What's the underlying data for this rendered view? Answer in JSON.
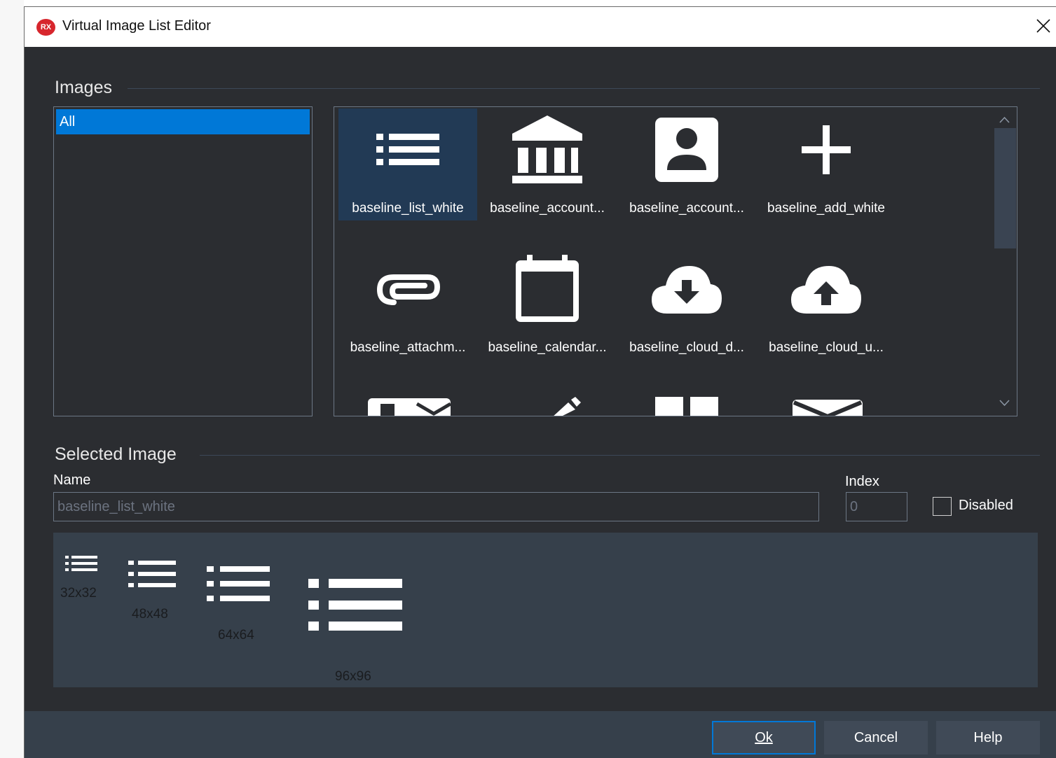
{
  "window": {
    "title": "Virtual Image List Editor",
    "logo_text": "RX"
  },
  "images_group": {
    "title": "Images"
  },
  "categories": [
    {
      "label": "All"
    }
  ],
  "image_grid": {
    "items": [
      {
        "label": "baseline_list_white",
        "icon": "list-icon",
        "selected": true
      },
      {
        "label": "baseline_account...",
        "icon": "account-balance-icon"
      },
      {
        "label": "baseline_account...",
        "icon": "account-box-icon"
      },
      {
        "label": "baseline_add_white",
        "icon": "add-icon"
      },
      {
        "label": "baseline_attachm...",
        "icon": "attachment-icon"
      },
      {
        "label": "baseline_calendar...",
        "icon": "calendar-icon"
      },
      {
        "label": "baseline_cloud_d...",
        "icon": "cloud-download-icon"
      },
      {
        "label": "baseline_cloud_u...",
        "icon": "cloud-upload-icon"
      }
    ]
  },
  "selected_group": {
    "title": "Selected Image",
    "name_label": "Name",
    "name_value": "baseline_list_white",
    "index_label": "Index",
    "index_value": "0",
    "disabled_label": "Disabled"
  },
  "previews": [
    {
      "label": "32x32"
    },
    {
      "label": "48x48"
    },
    {
      "label": "64x64"
    },
    {
      "label": "96x96"
    }
  ],
  "buttons": {
    "ok": "Ok",
    "cancel": "Cancel",
    "help": "Help"
  },
  "colors": {
    "background": "#2b2d31",
    "selection": "#0078d7",
    "selected_cell": "#223a55",
    "preview_bg": "#36404b"
  }
}
